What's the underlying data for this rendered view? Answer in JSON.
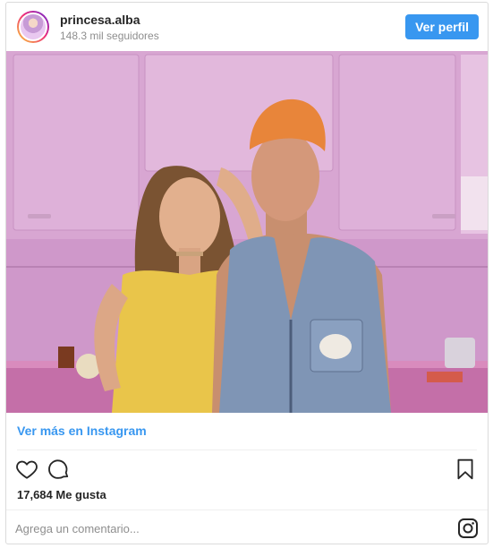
{
  "header": {
    "username": "princesa.alba",
    "followers": "148.3 mil seguidores",
    "profile_button": "Ver perfil"
  },
  "post": {
    "view_more": "Ver más en Instagram",
    "likes": "17,684 Me gusta"
  },
  "comment": {
    "placeholder": "Agrega un comentario..."
  },
  "icons": {
    "like": "heart-icon",
    "comment": "comment-bubble-icon",
    "save": "bookmark-icon",
    "brand": "instagram-icon"
  },
  "colors": {
    "accent": "#3897f0",
    "border": "#dbdbdb",
    "muted": "#8e8e8e"
  }
}
